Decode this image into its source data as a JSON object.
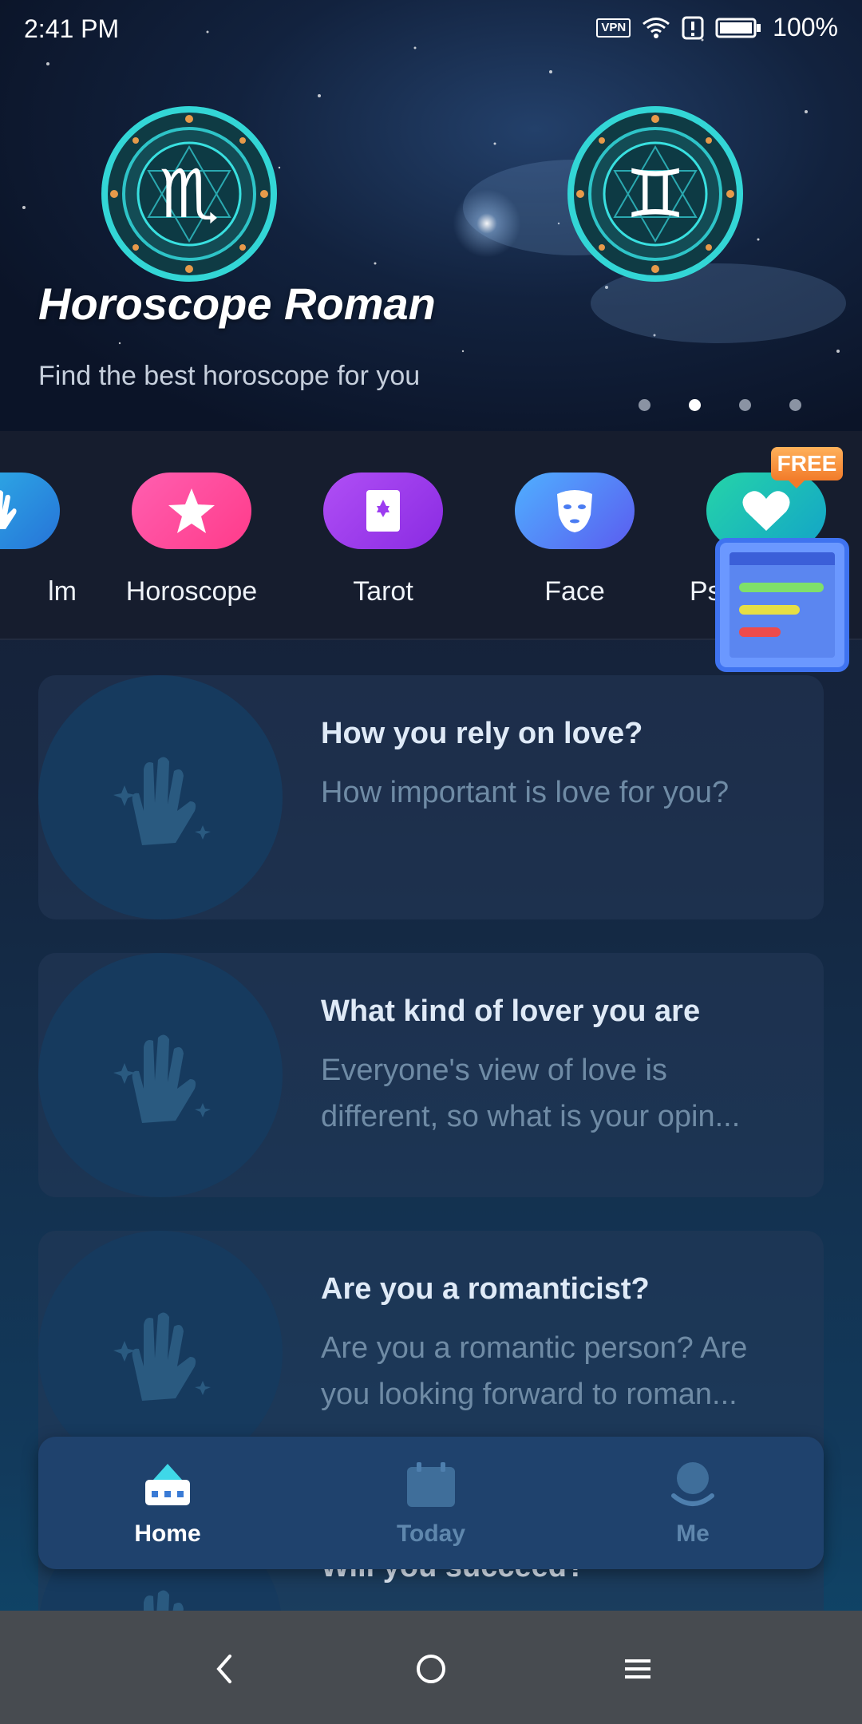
{
  "status_bar": {
    "time": "2:41 PM",
    "vpn": "VPN",
    "battery": "100%"
  },
  "hero": {
    "title": "Horoscope Roman",
    "subtitle": "Find the best horoscope for you",
    "page_count": 4,
    "active_page": 2,
    "left_sign_icon": "scorpio-icon",
    "right_sign_icon": "gemini-icon"
  },
  "categories": [
    {
      "label": "lm",
      "icon": "palm-hand-icon",
      "color": "#2f8bdc"
    },
    {
      "label": "Horoscope",
      "icon": "star-icon",
      "color": "#ff4fa0"
    },
    {
      "label": "Tarot",
      "icon": "tarot-card-icon",
      "color": "#9c3cf0"
    },
    {
      "label": "Face",
      "icon": "face-mask-icon",
      "color": "#3b82f6"
    },
    {
      "label": "Ps",
      "icon": "heart-icon",
      "color": "#19c29a"
    }
  ],
  "free_badge": "FREE",
  "floating_widget": {
    "icon": "report-widget-icon"
  },
  "cards": [
    {
      "title": "How you rely on love?",
      "desc_line1": "How important is love for you?",
      "desc_line2": "",
      "icon": "palm-hand-icon"
    },
    {
      "title": "What kind of lover you are",
      "desc_line1": "Everyone's view of love is",
      "desc_line2": "different, so what is your opin...",
      "icon": "palm-hand-icon"
    },
    {
      "title": "Are you a romanticist?",
      "desc_line1": "Are you a romantic person? Are",
      "desc_line2": "you looking forward to roman...",
      "icon": "palm-hand-icon"
    },
    {
      "title": "Will you succeed?",
      "desc_line1": "",
      "desc_line2": "",
      "icon": "palm-hand-icon"
    }
  ],
  "tabs": [
    {
      "label": "Home",
      "icon": "home-icon",
      "active": true
    },
    {
      "label": "Today",
      "icon": "calendar-icon",
      "active": false
    },
    {
      "label": "Me",
      "icon": "profile-icon",
      "active": false
    }
  ],
  "nav": {
    "back": "back-icon",
    "home": "home-circle-icon",
    "menu": "menu-icon"
  }
}
